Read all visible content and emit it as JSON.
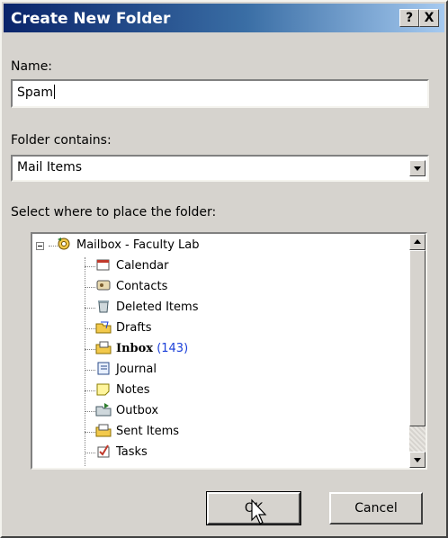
{
  "dialog": {
    "title": "Create New Folder",
    "help_button": "?",
    "close_button": "X"
  },
  "name_field": {
    "label": "Name:",
    "value": "Spam"
  },
  "folder_contains": {
    "label": "Folder contains:",
    "selected": "Mail Items"
  },
  "placement": {
    "label": "Select where to place the folder:"
  },
  "tree": {
    "root": "Mailbox - Faculty Lab",
    "items": [
      {
        "label": "Calendar",
        "icon": "calendar-icon"
      },
      {
        "label": "Contacts",
        "icon": "contacts-icon"
      },
      {
        "label": "Deleted Items",
        "icon": "deleted-items-icon"
      },
      {
        "label": "Drafts",
        "icon": "drafts-icon"
      },
      {
        "label": "Inbox",
        "count": "(143)",
        "icon": "inbox-icon"
      },
      {
        "label": "Journal",
        "icon": "journal-icon"
      },
      {
        "label": "Notes",
        "icon": "notes-icon"
      },
      {
        "label": "Outbox",
        "icon": "outbox-icon"
      },
      {
        "label": "Sent Items",
        "icon": "sent-items-icon"
      },
      {
        "label": "Tasks",
        "icon": "tasks-icon"
      }
    ]
  },
  "buttons": {
    "ok": "OK",
    "cancel": "Cancel"
  },
  "colors": {
    "title_start": "#0a246a",
    "title_end": "#a6caf0",
    "dialog_face": "#d6d3ce",
    "count_text": "#1a3fd9"
  }
}
